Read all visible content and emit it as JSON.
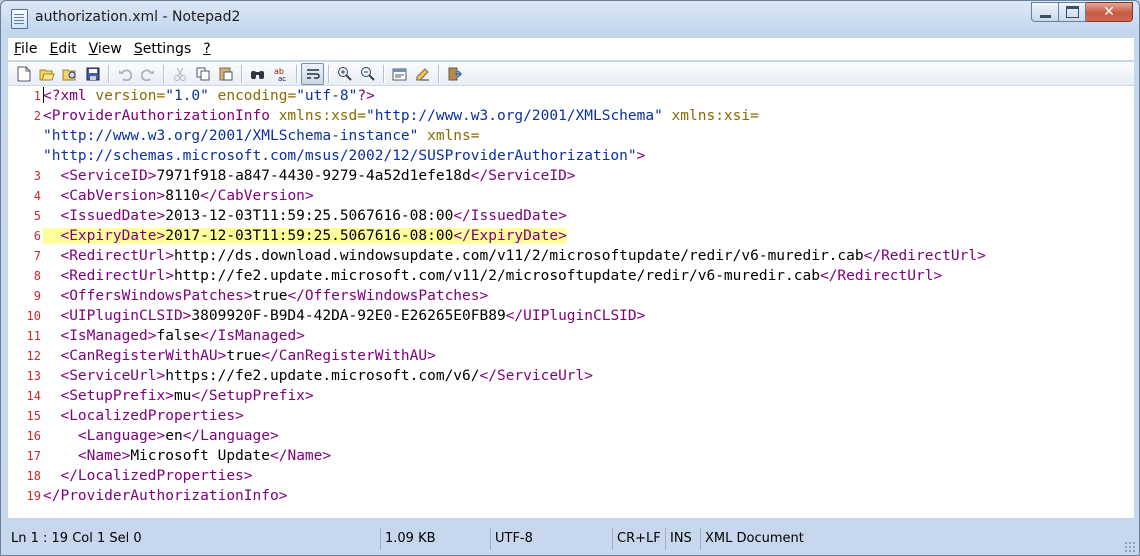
{
  "window": {
    "title": "authorization.xml - Notepad2"
  },
  "menu": [
    {
      "label": "File",
      "accel": "F",
      "rest": "ile"
    },
    {
      "label": "Edit",
      "accel": "E",
      "rest": "dit"
    },
    {
      "label": "View",
      "accel": "V",
      "rest": "iew"
    },
    {
      "label": "Settings",
      "accel": "S",
      "rest": "ettings"
    },
    {
      "label": "?",
      "accel": "?",
      "rest": ""
    }
  ],
  "toolbar": {
    "icons": [
      "new-file-icon",
      "open-file-icon",
      "browse-icon",
      "save-icon",
      "undo-icon",
      "redo-icon",
      "cut-icon",
      "copy-icon",
      "paste-icon",
      "find-icon",
      "replace-icon",
      "word-wrap-icon",
      "zoom-in-icon",
      "zoom-out-icon",
      "scheme-icon",
      "customize-schemes-icon",
      "exit-icon"
    ],
    "active": "word-wrap-icon"
  },
  "editor": {
    "current_line": 1,
    "highlighted_line": 6,
    "lines": [
      {
        "n": "1",
        "segs": [
          [
            "decl",
            "<?xml "
          ],
          [
            "attr",
            "version="
          ],
          [
            "str",
            "\"1.0\""
          ],
          [
            "attr",
            " encoding="
          ],
          [
            "str",
            "\"utf-8\""
          ],
          [
            "decl",
            "?>"
          ]
        ]
      },
      {
        "n": "2",
        "segs": [
          [
            "tag",
            "<ProviderAuthorizationInfo "
          ],
          [
            "attr",
            "xmlns:xsd="
          ],
          [
            "str",
            "\"http://www.w3.org/2001/XMLSchema\""
          ],
          [
            "attr",
            " xmlns:xsi="
          ]
        ]
      },
      {
        "n": "",
        "segs": [
          [
            "str",
            "\"http://www.w3.org/2001/XMLSchema-instance\""
          ],
          [
            "attr",
            " xmlns="
          ]
        ]
      },
      {
        "n": "",
        "segs": [
          [
            "str",
            "\"http://schemas.microsoft.com/msus/2002/12/SUSProviderAuthorization\""
          ],
          [
            "tag",
            ">"
          ]
        ]
      },
      {
        "n": "3",
        "segs": [
          [
            "tag",
            "  <ServiceID>"
          ],
          [
            "txt",
            "7971f918-a847-4430-9279-4a52d1efe18d"
          ],
          [
            "tag",
            "</ServiceID>"
          ]
        ]
      },
      {
        "n": "4",
        "segs": [
          [
            "tag",
            "  <CabVersion>"
          ],
          [
            "txt",
            "8110"
          ],
          [
            "tag",
            "</CabVersion>"
          ]
        ]
      },
      {
        "n": "5",
        "segs": [
          [
            "tag",
            "  <IssuedDate>"
          ],
          [
            "txt",
            "2013-12-03T11:59:25.5067616-08:00"
          ],
          [
            "tag",
            "</IssuedDate>"
          ]
        ]
      },
      {
        "n": "6",
        "segs": [
          [
            "tag",
            "  <ExpiryDate>"
          ],
          [
            "txt",
            "2017-12-03T11:59:25.5067616-08:00"
          ],
          [
            "tag",
            "</ExpiryDate>"
          ]
        ]
      },
      {
        "n": "7",
        "segs": [
          [
            "tag",
            "  <RedirectUrl>"
          ],
          [
            "txt",
            "http://ds.download.windowsupdate.com/v11/2/microsoftupdate/redir/v6-muredir.cab"
          ],
          [
            "tag",
            "</RedirectUrl>"
          ]
        ]
      },
      {
        "n": "8",
        "segs": [
          [
            "tag",
            "  <RedirectUrl>"
          ],
          [
            "txt",
            "http://fe2.update.microsoft.com/v11/2/microsoftupdate/redir/v6-muredir.cab"
          ],
          [
            "tag",
            "</RedirectUrl>"
          ]
        ]
      },
      {
        "n": "9",
        "segs": [
          [
            "tag",
            "  <OffersWindowsPatches>"
          ],
          [
            "txt",
            "true"
          ],
          [
            "tag",
            "</OffersWindowsPatches>"
          ]
        ]
      },
      {
        "n": "10",
        "segs": [
          [
            "tag",
            "  <UIPluginCLSID>"
          ],
          [
            "txt",
            "3809920F-B9D4-42DA-92E0-E26265E0FB89"
          ],
          [
            "tag",
            "</UIPluginCLSID>"
          ]
        ]
      },
      {
        "n": "11",
        "segs": [
          [
            "tag",
            "  <IsManaged>"
          ],
          [
            "txt",
            "false"
          ],
          [
            "tag",
            "</IsManaged>"
          ]
        ]
      },
      {
        "n": "12",
        "segs": [
          [
            "tag",
            "  <CanRegisterWithAU>"
          ],
          [
            "txt",
            "true"
          ],
          [
            "tag",
            "</CanRegisterWithAU>"
          ]
        ]
      },
      {
        "n": "13",
        "segs": [
          [
            "tag",
            "  <ServiceUrl>"
          ],
          [
            "txt",
            "https://fe2.update.microsoft.com/v6/"
          ],
          [
            "tag",
            "</ServiceUrl>"
          ]
        ]
      },
      {
        "n": "14",
        "segs": [
          [
            "tag",
            "  <SetupPrefix>"
          ],
          [
            "txt",
            "mu"
          ],
          [
            "tag",
            "</SetupPrefix>"
          ]
        ]
      },
      {
        "n": "15",
        "segs": [
          [
            "tag",
            "  <LocalizedProperties>"
          ]
        ]
      },
      {
        "n": "16",
        "segs": [
          [
            "tag",
            "    <Language>"
          ],
          [
            "txt",
            "en"
          ],
          [
            "tag",
            "</Language>"
          ]
        ]
      },
      {
        "n": "17",
        "segs": [
          [
            "tag",
            "    <Name>"
          ],
          [
            "txt",
            "Microsoft Update"
          ],
          [
            "tag",
            "</Name>"
          ]
        ]
      },
      {
        "n": "18",
        "segs": [
          [
            "tag",
            "  </LocalizedProperties>"
          ]
        ]
      },
      {
        "n": "19",
        "segs": [
          [
            "tag",
            "</ProviderAuthorizationInfo>"
          ]
        ]
      }
    ]
  },
  "status": {
    "position": "Ln 1 : 19   Col 1   Sel 0",
    "size": "1.09 KB",
    "encoding": "UTF-8",
    "eol": "CR+LF",
    "mode": "INS",
    "lexer": "XML Document"
  },
  "colors": {
    "tag": "#800080",
    "attribute": "#8a6a00",
    "string": "#0b2fa5",
    "line_number": "#cc2a2a",
    "highlight": "#ffff99"
  }
}
